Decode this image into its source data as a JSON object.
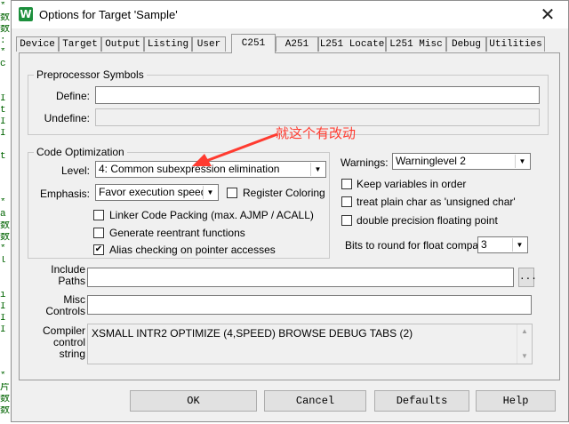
{
  "editor": {
    "lines": [
      "*",
      "数",
      "数",
      ":",
      "*",
      "c",
      "",
      "",
      "I",
      "t",
      "I",
      "I",
      "",
      "t",
      "",
      "",
      "",
      "*",
      "a",
      "数",
      "数",
      "*",
      "l",
      "",
      "",
      "i",
      "I",
      "I",
      "I",
      "",
      "",
      "",
      "*",
      "片",
      "数",
      "数"
    ]
  },
  "window": {
    "title": "Options for Target 'Sample'",
    "close_glyph": "✕",
    "app_icon_glyph": "W"
  },
  "tabs": [
    "Device",
    "Target",
    "Output",
    "Listing",
    "User",
    "C251",
    "A251",
    "L251 Locate",
    "L251 Misc",
    "Debug",
    "Utilities"
  ],
  "preprocessor": {
    "legend": "Preprocessor Symbols",
    "define_label": "Define:",
    "define_value": "",
    "undefine_label": "Undefine:",
    "undefine_value": ""
  },
  "optimization": {
    "legend": "Code Optimization",
    "level_label": "Level:",
    "level_value": "4: Common subexpression elimination",
    "emphasis_label": "Emphasis:",
    "emphasis_value": "Favor execution speed",
    "register_coloring": {
      "label": "Register Coloring",
      "checked": false
    },
    "linker_packing": {
      "label": "Linker Code Packing (max. AJMP / ACALL)",
      "checked": false
    },
    "reentrant": {
      "label": "Generate reentrant functions",
      "checked": false
    },
    "alias": {
      "label": "Alias checking on pointer accesses",
      "checked": true
    }
  },
  "annotation": "就这个有改动",
  "right": {
    "warnings_label": "Warnings:",
    "warnings_value": "Warninglevel 2",
    "keep_vars": {
      "label": "Keep variables in order",
      "checked": false
    },
    "plain_char": {
      "label": "treat plain char as 'unsigned char'",
      "checked": false
    },
    "double_prec": {
      "label": "double precision floating point",
      "checked": false
    },
    "bits_label": "Bits to round for float compare:",
    "bits_value": "3"
  },
  "include_paths": {
    "label_line1": "Include",
    "label_line2": "Paths",
    "value": "",
    "browse_label": "..."
  },
  "misc_controls": {
    "label_line1": "Misc",
    "label_line2": "Controls",
    "value": ""
  },
  "compiler_control": {
    "label_line1": "Compiler",
    "label_line2": "control",
    "label_line3": "string",
    "value": "XSMALL INTR2 OPTIMIZE (4,SPEED) BROWSE DEBUG TABS (2)"
  },
  "buttons": {
    "ok": "OK",
    "cancel": "Cancel",
    "defaults": "Defaults",
    "help": "Help"
  },
  "colors": {
    "annotation": "#ff3b30",
    "dialog_bg": "#f0f0f0"
  }
}
